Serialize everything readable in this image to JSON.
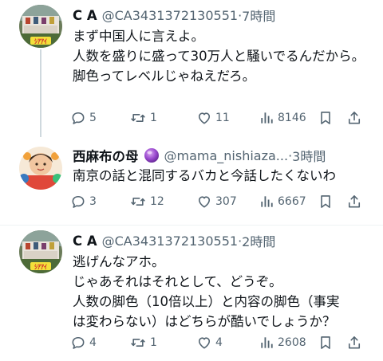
{
  "tweets": [
    {
      "name": "C A",
      "handle": "@CA3431372130551",
      "dot": "·",
      "time": "7時間",
      "lines": [
        "まず中国人に言えよ。",
        "人数を盛りに盛って30万人と騒いでるんだから。",
        "脚色ってレベルじゃねえだろ。"
      ],
      "replies": "5",
      "retweets": "1",
      "likes": "11",
      "views": "8146"
    },
    {
      "name": "西麻布の母",
      "handle": "@mama_nishiaza...",
      "dot": "·",
      "time": "3時間",
      "lines": [
        "南京の話と混同するバカと今話したくないわ"
      ],
      "replies": "3",
      "retweets": "12",
      "likes": "307",
      "views": "6667"
    },
    {
      "name": "C A",
      "handle": "@CA3431372130551",
      "dot": "·",
      "time": "2時間",
      "lines": [
        "逃げんなアホ。",
        "じゃあそれはそれとして、どうぞ。",
        "人数の脚色（10倍以上）と内容の脚色（事実",
        "は変わらない）はどちらが酷いでしょうか？"
      ],
      "replies": "4",
      "retweets": "1",
      "likes": "4",
      "views": "2608"
    }
  ],
  "icons": {
    "reply": "reply-icon",
    "retweet": "retweet-icon",
    "like": "heart-icon",
    "views": "views-icon",
    "bookmark": "bookmark-icon",
    "share": "share-icon"
  },
  "colors": {
    "text": "#0f1419",
    "secondary": "#536471",
    "thread_line": "#cfd9de",
    "verified_badge": "#8e44ad"
  }
}
